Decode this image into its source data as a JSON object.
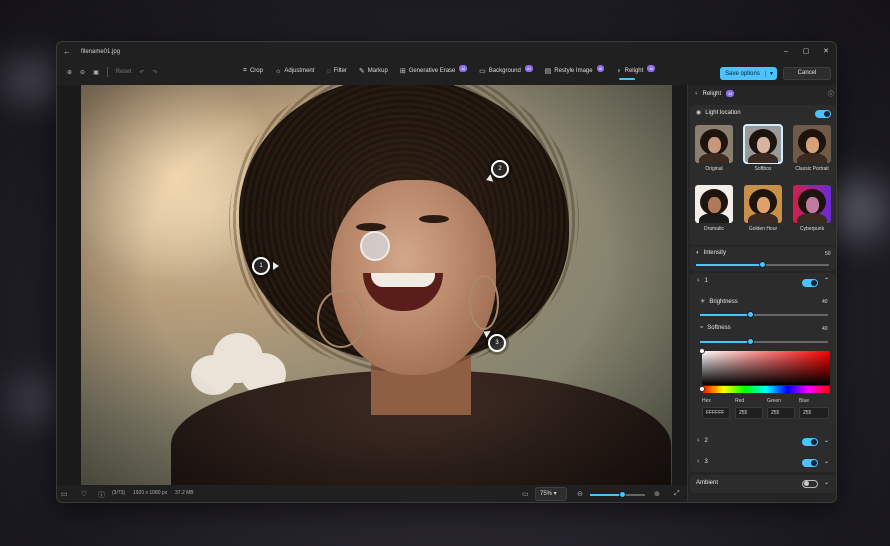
{
  "window": {
    "filename": "filename01.jpg",
    "controls": [
      "–",
      "▢",
      "✕"
    ]
  },
  "toolbar_left": {
    "reset": "Reset"
  },
  "tools": [
    {
      "label": "Crop",
      "icon": "crop-icon",
      "glyph": "⌗"
    },
    {
      "label": "Adjustment",
      "icon": "adjustment-icon",
      "glyph": "☼"
    },
    {
      "label": "Filter",
      "icon": "filter-icon",
      "glyph": "◌"
    },
    {
      "label": "Markup",
      "icon": "markup-icon",
      "glyph": "✎"
    },
    {
      "label": "Generative Erase",
      "icon": "eraser-icon",
      "glyph": "⊞",
      "badge": "AI"
    },
    {
      "label": "Background",
      "icon": "background-icon",
      "glyph": "▭",
      "badge": "AI"
    },
    {
      "label": "Restyle Image",
      "icon": "restyle-icon",
      "glyph": "▤",
      "badge": "AI"
    },
    {
      "label": "Relight",
      "icon": "relight-icon",
      "glyph": "♀",
      "badge": "AI"
    }
  ],
  "actions": {
    "save": "Save options",
    "cancel": "Cancel"
  },
  "pins": [
    "1",
    "2",
    "3"
  ],
  "status": {
    "index": "(3/73)",
    "resolution": "1920 x 1080 px",
    "size": "37.2 MB",
    "zoom": "75%",
    "zoom_level": 0.6
  },
  "panel": {
    "title": "Relight",
    "badge": "AI",
    "light_location": "Light location",
    "presets": [
      "Original",
      "Softbox",
      "Classic Portrait",
      "Dramatic",
      "Golden Hour",
      "Cyberpunk"
    ],
    "intensity": {
      "label": "Intensity",
      "value": "50",
      "level": 0.5
    },
    "light1": {
      "name": "1",
      "brightness": {
        "label": "Brightness",
        "value": "40",
        "level": 0.4
      },
      "softness": {
        "label": "Softness",
        "value": "40",
        "level": 0.4
      }
    },
    "color": {
      "hex_label": "Hex",
      "red_label": "Red",
      "green_label": "Green",
      "blue_label": "Blue",
      "hex": "FFFFFF",
      "red": "255",
      "green": "255",
      "blue": "255"
    },
    "light2": "2",
    "light3": "3",
    "ambient": "Ambient"
  }
}
